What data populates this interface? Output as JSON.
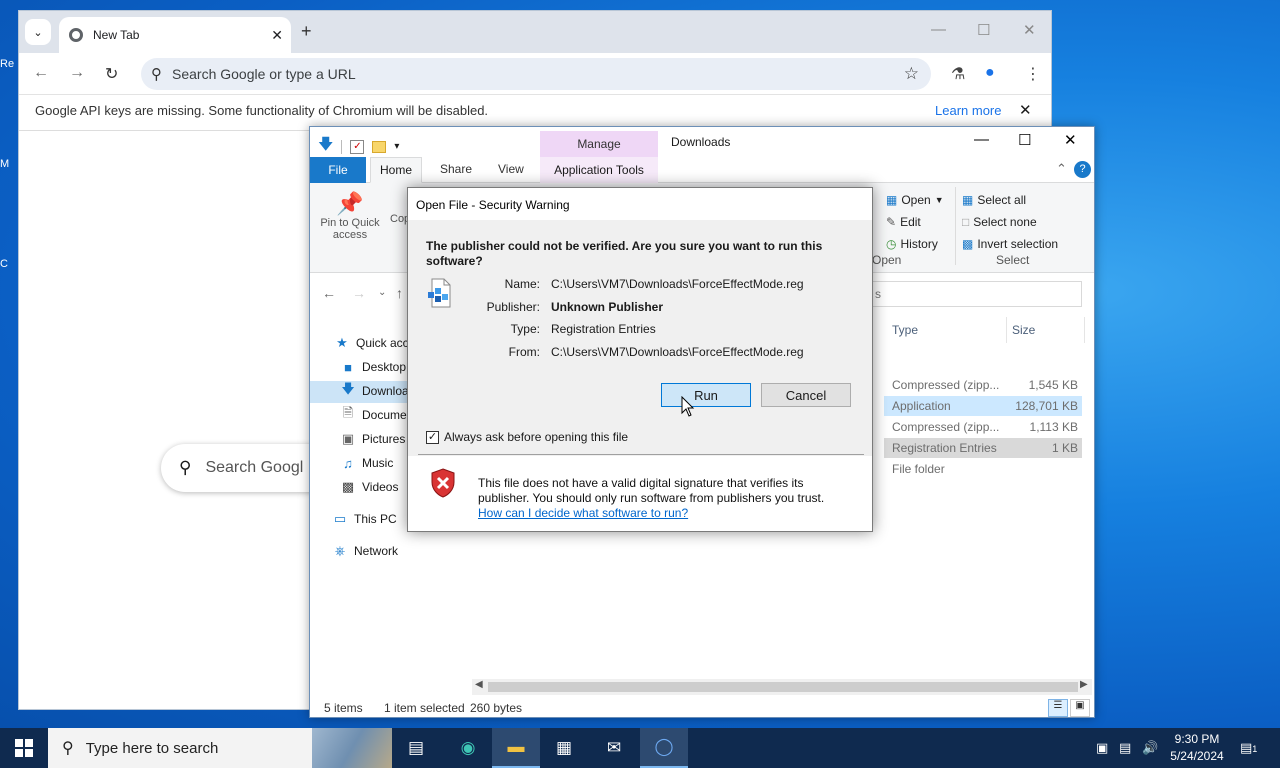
{
  "desktop": {
    "icon_labels": [
      "Re",
      "M",
      "C"
    ]
  },
  "chrome": {
    "tab_title": "New Tab",
    "omnibox_placeholder": "Search Google or type a URL",
    "infobar_message": "Google API keys are missing. Some functionality of Chromium will be disabled.",
    "infobar_link": "Learn more",
    "page_search_placeholder": "Search Googl"
  },
  "explorer": {
    "title": "Downloads",
    "manage_tab": "Manage",
    "tabs": {
      "file": "File",
      "home": "Home",
      "share": "Share",
      "view": "View",
      "app_tools": "Application Tools"
    },
    "ribbon": {
      "pin": "Pin to Quick access",
      "copy": "Cop",
      "open": "Open",
      "edit": "Edit",
      "history": "History",
      "open_group": "Open",
      "select_all": "Select all",
      "select_none": "Select none",
      "invert_selection": "Invert selection",
      "select_group": "Select"
    },
    "search_placeholder": "s",
    "nav": {
      "quick_access": "Quick acc",
      "desktop": "Desktop",
      "downloads": "Downloa",
      "documents": "Docume",
      "pictures": "Pictures",
      "music": "Music",
      "videos": "Videos",
      "this_pc": "This PC",
      "network": "Network"
    },
    "columns": {
      "type": "Type",
      "size": "Size"
    },
    "rows": [
      {
        "type": "Compressed (zipp...",
        "size": "1,545 KB"
      },
      {
        "type": "Application",
        "size": "128,701 KB"
      },
      {
        "type": "Compressed (zipp...",
        "size": "1,113 KB"
      },
      {
        "type": "Registration Entries",
        "size": "1 KB"
      },
      {
        "type": "File folder",
        "size": ""
      }
    ],
    "status": {
      "items": "5 items",
      "selected": "1 item selected",
      "bytes": "260 bytes"
    }
  },
  "dialog": {
    "title": "Open File - Security Warning",
    "question": "The publisher could not be verified.  Are you sure you want to run this software?",
    "labels": {
      "name": "Name:",
      "publisher": "Publisher:",
      "type": "Type:",
      "from": "From:"
    },
    "values": {
      "name": "C:\\Users\\VM7\\Downloads\\ForceEffectMode.reg",
      "publisher": "Unknown Publisher",
      "type": "Registration Entries",
      "from": "C:\\Users\\VM7\\Downloads\\ForceEffectMode.reg"
    },
    "run_button": "Run",
    "cancel_button": "Cancel",
    "checkbox_label": "Always ask before opening this file",
    "checkbox_checked": true,
    "warning_text": "This file does not have a valid digital signature that verifies its publisher.  You should only run software from publishers you trust.",
    "warning_link": "How can I decide what software to run?"
  },
  "taskbar": {
    "search_placeholder": "Type here to search",
    "time": "9:30 PM",
    "date": "5/24/2024",
    "notification_count": "1"
  },
  "colors": {
    "accent": "#0078d7",
    "taskbar": "#0f2a4f",
    "file_tab": "#1979ca",
    "manage_tab": "#efd7f6"
  }
}
